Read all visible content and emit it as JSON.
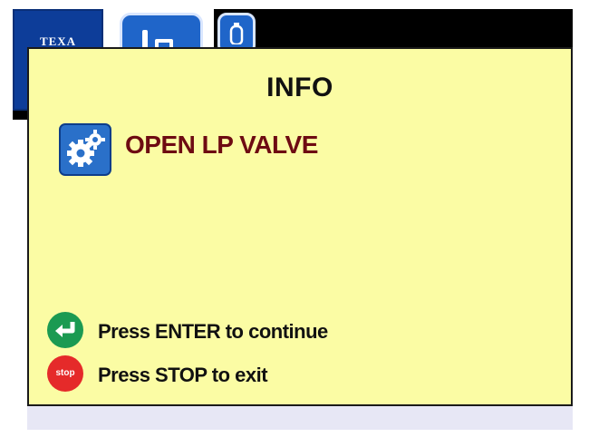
{
  "header": {
    "logo_text": "TEXA"
  },
  "dialog": {
    "title": "INFO",
    "message": "OPEN LP VALVE",
    "actions": [
      {
        "icon": "enter-icon",
        "label": "Press ENTER to continue",
        "color": "#1b9a52"
      },
      {
        "icon": "stop-icon",
        "badge": "stop",
        "label": "Press STOP to exit",
        "color": "#e52a2a"
      }
    ]
  },
  "colors": {
    "dialog_background": "#fbfca4",
    "message_text": "#6e0b12",
    "logo_background": "#0d3d99",
    "tab_background": "#1f65c9"
  }
}
